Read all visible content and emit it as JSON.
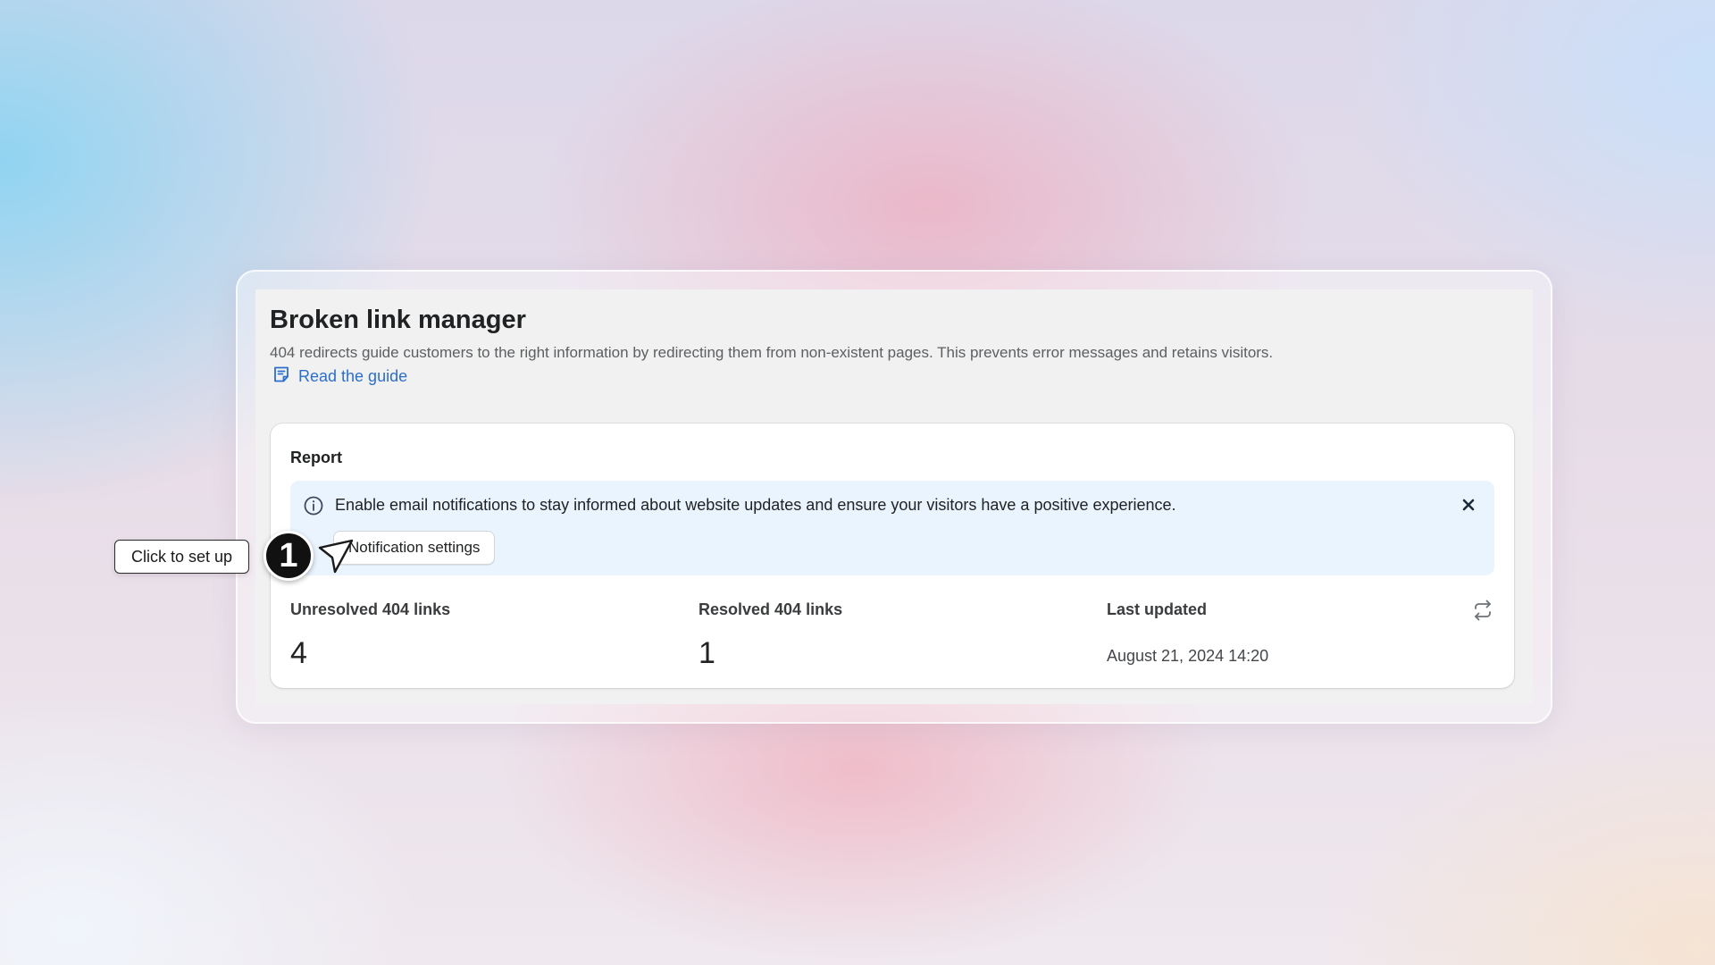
{
  "page": {
    "title": "Broken link manager",
    "description": "404 redirects guide customers to the right information by redirecting them from non-existent pages. This prevents error messages and retains visitors.",
    "guide_link": "Read the guide"
  },
  "report": {
    "title": "Report",
    "banner": {
      "text": "Enable email notifications to stay informed about website updates and ensure your visitors have a positive experience.",
      "button_label": "Notification settings",
      "icon": "info-icon",
      "close_icon": "close-icon"
    },
    "stats": [
      {
        "label": "Unresolved 404 links",
        "value": "4"
      },
      {
        "label": "Resolved 404 links",
        "value": "1"
      },
      {
        "label": "Last updated",
        "value": "August 21, 2024 14:20"
      }
    ],
    "refresh_icon": "refresh-icon"
  },
  "annotation": {
    "callout_text": "Click to set up",
    "step_number": "1"
  },
  "colors": {
    "link": "#2c6ecb",
    "banner_bg": "#eaf4ff",
    "text": "#202223"
  }
}
